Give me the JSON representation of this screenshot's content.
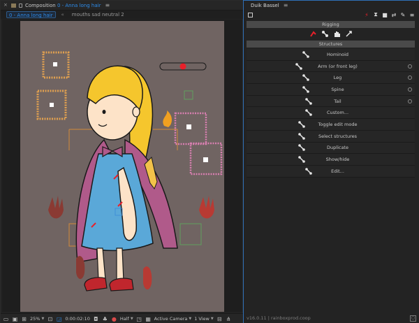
{
  "composition": {
    "header_title_prefix": "Composition",
    "header_title_name": "0 - Anna long hair",
    "menu_glyph": "≡",
    "tabs": [
      {
        "label": "0 - Anna long hair",
        "active": true
      },
      {
        "label": "mouths sad neutral 2",
        "active": false
      }
    ],
    "tab_separator": "«",
    "footer": {
      "zoom": "25%",
      "timecode": "0:00:02:10",
      "resolution": "Half",
      "camera": "Active Camera",
      "view": "1 View"
    }
  },
  "duik": {
    "panel_title": "Duik Bassel",
    "menu_glyph": "≡",
    "toolbar_icons": [
      "layer-icon",
      "rigging-icon",
      "hourglass-icon",
      "camera-icon",
      "swap-icon",
      "wrench-icon",
      "settings-icon"
    ],
    "rigging_label": "Rigging",
    "rig_icons": [
      "link-icon",
      "bones-icon",
      "hand-icon",
      "automation-icon"
    ],
    "structures_label": "Structures",
    "structures": [
      {
        "label": "Hominoid",
        "icon": "hominoid-icon",
        "has_options": false
      },
      {
        "label": "Arm (or front leg)",
        "icon": "arm-icon",
        "has_options": true
      },
      {
        "label": "Leg",
        "icon": "leg-icon",
        "has_options": true
      },
      {
        "label": "Spine",
        "icon": "spine-icon",
        "has_options": true
      },
      {
        "label": "Tail",
        "icon": "tail-icon",
        "has_options": true
      },
      {
        "label": "Custom...",
        "icon": "custom-bone-icon",
        "has_options": false
      },
      {
        "label": "Toggle edit mode",
        "icon": "edit-mode-icon",
        "has_options": false
      },
      {
        "label": "Select structures",
        "icon": "select-icon",
        "has_options": false
      },
      {
        "label": "Duplicate",
        "icon": "duplicate-icon",
        "has_options": false
      },
      {
        "label": "Show/hide",
        "icon": "show-hide-icon",
        "has_options": false
      },
      {
        "label": "Edit...",
        "icon": "edit-icon",
        "has_options": false
      }
    ],
    "version": "v16.0.11 | rainboxprod.coop"
  },
  "colors": {
    "accent": "#2d8ceb",
    "canvas_bg": "#706462",
    "dark_red": "#b8282a"
  }
}
